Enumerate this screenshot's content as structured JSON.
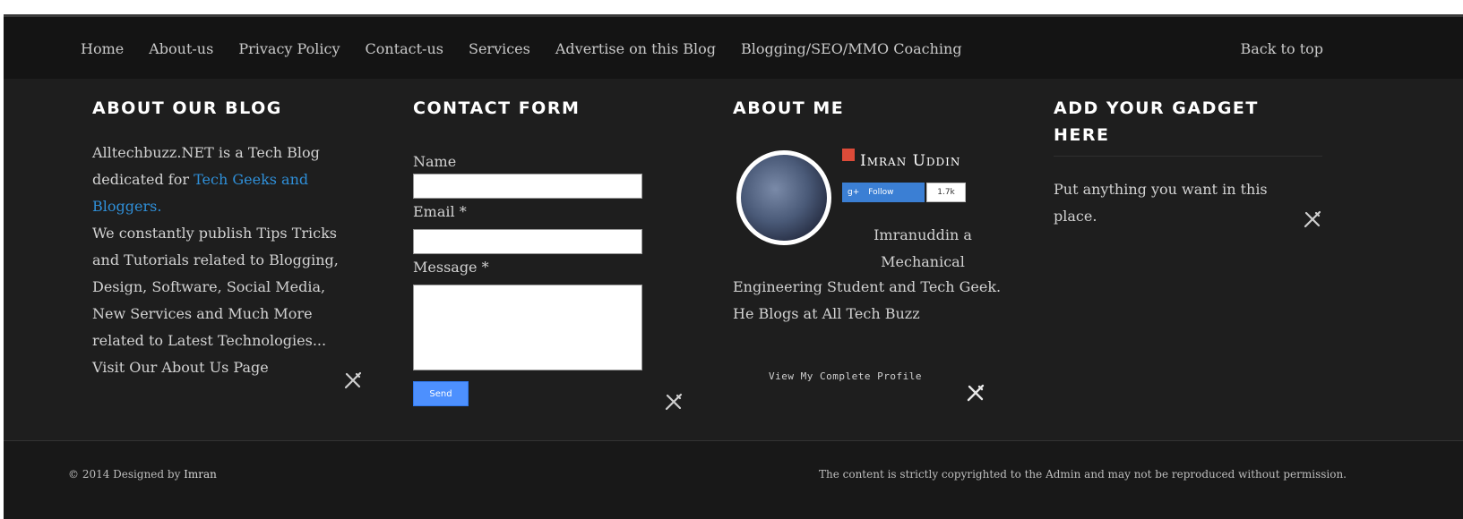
{
  "nav": {
    "links": [
      "Home",
      "About-us",
      "Privacy Policy",
      "Contact-us",
      "Services",
      "Advertise on this Blog",
      "Blogging/SEO/MMO Coaching"
    ],
    "back_to_top": "Back to top"
  },
  "about_blog": {
    "title": "ABOUT OUR BLOG",
    "intro": "Alltechbuzz.NET is a Tech Blog dedicated for ",
    "link": "Tech Geeks and Bloggers.",
    "body": "We constantly publish Tips Tricks and Tutorials related to Blogging, Design, Software, Social Media, New Services and Much More related to Latest Technologies...",
    "about_link": "Visit Our About Us Page"
  },
  "contact_form": {
    "title": "CONTACT FORM",
    "name_label": "Name",
    "email_label": "Email *",
    "message_label": "Message *",
    "send_label": "Send",
    "name_value": "",
    "email_value": "",
    "message_value": ""
  },
  "about_me": {
    "title": "ABOUT ME",
    "name": "Imran Uddin",
    "follow_label": "Follow",
    "follower_count": "1.7k",
    "bio_line1": "Imranuddin a Mechanical",
    "bio_line2": "Engineering Student and Tech Geek.",
    "bio_line3": "He Blogs at All Tech Buzz",
    "profile_link": "View My Complete Profile"
  },
  "gadget": {
    "title": "ADD YOUR GADGET HERE",
    "body": "Put anything you want in this place."
  },
  "footer": {
    "copyright_prefix": "© 2014 Designed by ",
    "designer": "Imran",
    "notice": "The content is strictly copyrighted to the Admin and may not be reproduced without permission."
  },
  "icons": {
    "edit_tool": "wrench-screwdriver-icon",
    "google_plus": "google-plus-icon"
  },
  "colors": {
    "background": "#1e1e1e",
    "nav_background": "#141414",
    "link_blue": "#2f8fd8",
    "send_button": "#4d90fe",
    "google_red": "#dd4b39"
  }
}
